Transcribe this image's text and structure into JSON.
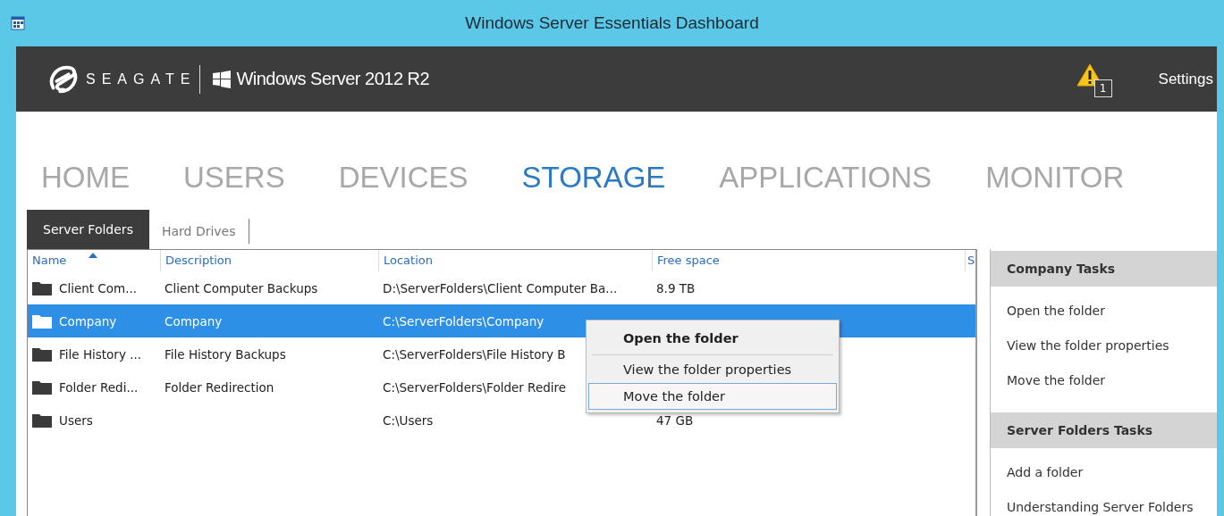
{
  "window": {
    "title": "Windows Server Essentials Dashboard"
  },
  "header": {
    "brand": "SEAGATE",
    "product": "Windows Server 2012 R2",
    "alert_count": "1",
    "settings": "Settings"
  },
  "nav": [
    {
      "label": "HOME",
      "selected": false
    },
    {
      "label": "USERS",
      "selected": false
    },
    {
      "label": "DEVICES",
      "selected": false
    },
    {
      "label": "STORAGE",
      "selected": true
    },
    {
      "label": "APPLICATIONS",
      "selected": false
    },
    {
      "label": "MONITOR",
      "selected": false
    }
  ],
  "tabs": [
    {
      "label": "Server Folders",
      "selected": true
    },
    {
      "label": "Hard Drives",
      "selected": false
    }
  ],
  "table": {
    "columns": [
      "Name",
      "Description",
      "Location",
      "Free space",
      "S"
    ],
    "rows": [
      {
        "name": "Client Com...",
        "description": "Client Computer Backups",
        "location": "D:\\ServerFolders\\Client Computer Ba...",
        "free_space": "8.9 TB",
        "selected": false
      },
      {
        "name": "Company",
        "description": "Company",
        "location": "C:\\ServerFolders\\Company",
        "free_space": "",
        "selected": true
      },
      {
        "name": "File History ...",
        "description": "File History Backups",
        "location": "C:\\ServerFolders\\File History B",
        "free_space": "",
        "selected": false
      },
      {
        "name": "Folder Redi...",
        "description": "Folder Redirection",
        "location": "C:\\ServerFolders\\Folder Redire",
        "free_space": "",
        "selected": false
      },
      {
        "name": "Users",
        "description": "",
        "location": "C:\\Users",
        "free_space": "47 GB",
        "selected": false
      }
    ]
  },
  "context_menu": [
    {
      "label": "Open the folder",
      "kind": "default",
      "selected": false
    },
    {
      "label": "View the folder properties",
      "kind": "normal",
      "selected": false
    },
    {
      "label": "Move the folder",
      "kind": "normal",
      "selected": true
    }
  ],
  "tasks": [
    {
      "heading": "Company Tasks",
      "items": [
        "Open the folder",
        "View the folder properties",
        "Move the folder"
      ]
    },
    {
      "heading": "Server Folders Tasks",
      "items": [
        "Add a folder",
        "Understanding Server Folders"
      ]
    }
  ]
}
